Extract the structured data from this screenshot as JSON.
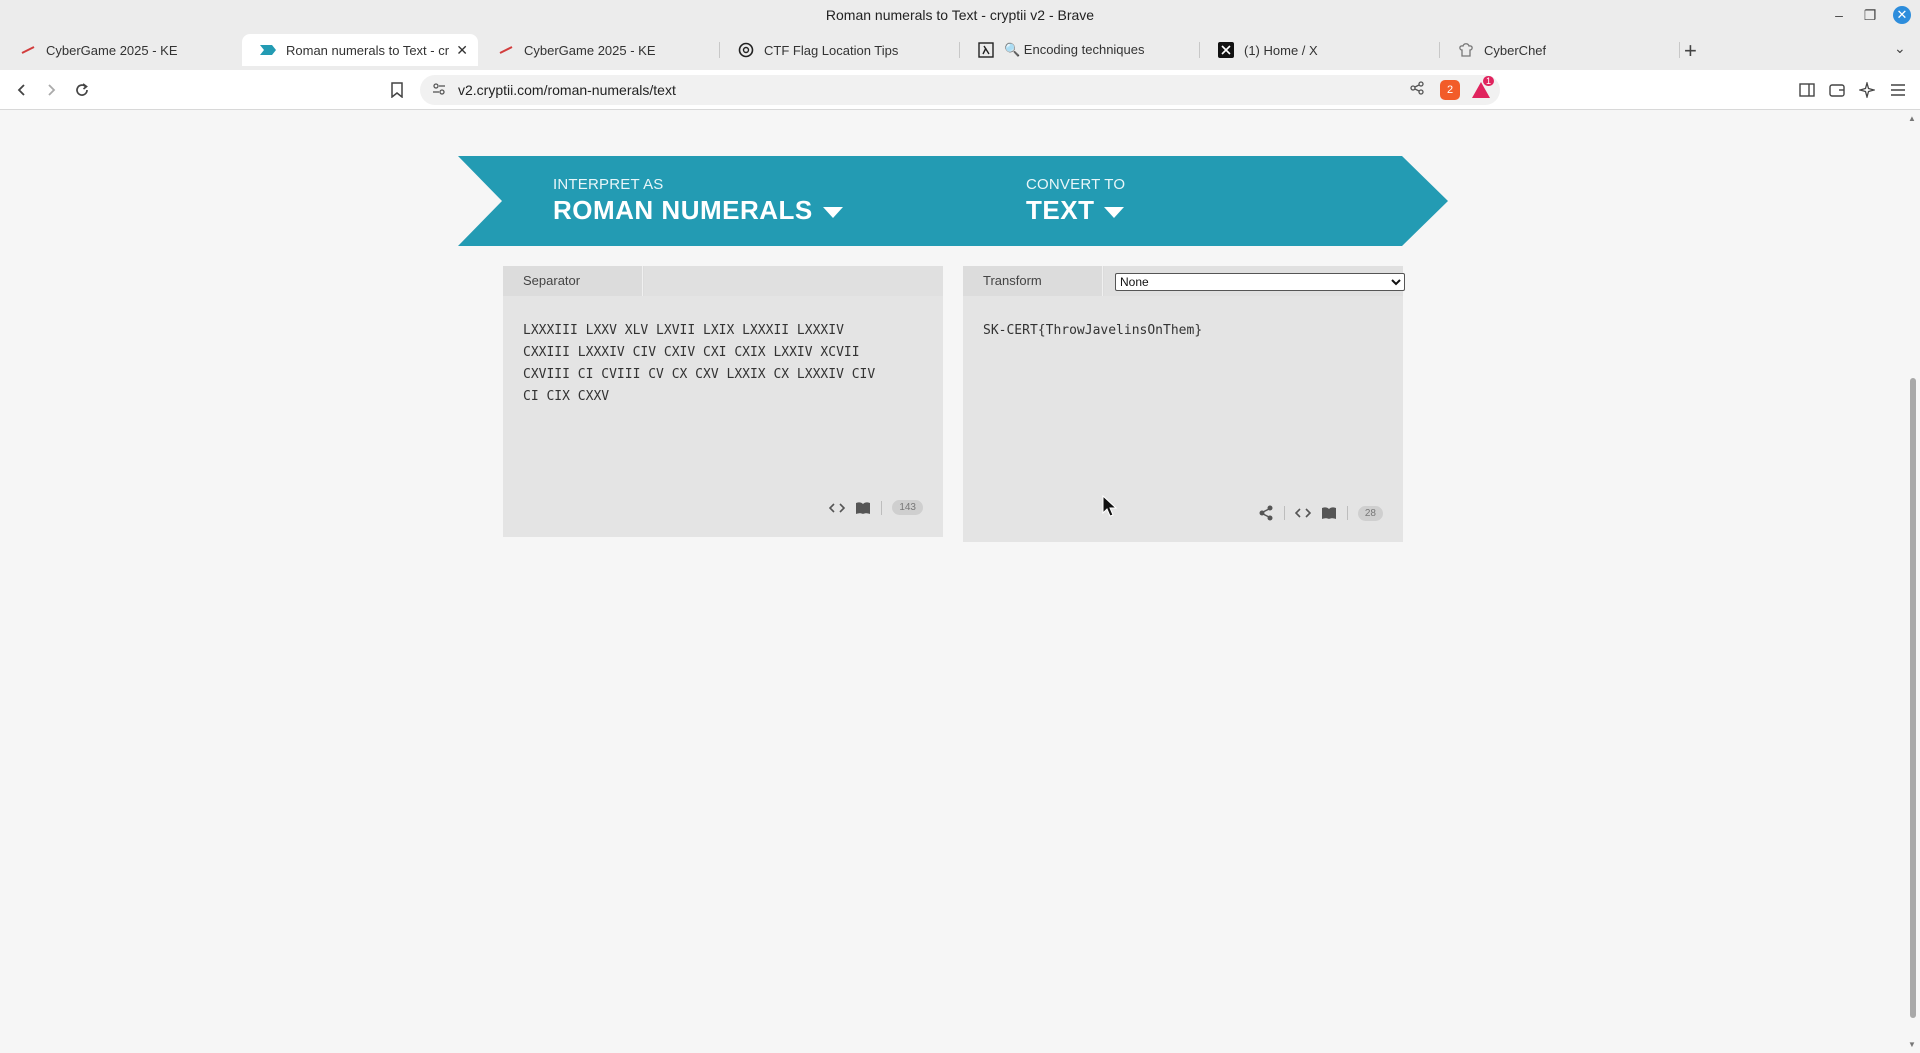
{
  "window": {
    "title": "Roman numerals to Text - cryptii v2 - Brave"
  },
  "tabs": [
    {
      "label": "CyberGame 2025 - KE",
      "icon": "cybergame-favicon",
      "active": false
    },
    {
      "label": "Roman numerals to Text - cr",
      "icon": "cryptii-favicon",
      "active": true
    },
    {
      "label": "CyberGame 2025 - KE",
      "icon": "cybergame-favicon",
      "active": false
    },
    {
      "label": "CTF Flag Location Tips",
      "icon": "chatgpt-favicon",
      "active": false
    },
    {
      "label": "🔍 Encoding techniques",
      "icon": "lambda-favicon",
      "active": false
    },
    {
      "label": "(1) Home / X",
      "icon": "x-favicon",
      "active": false
    },
    {
      "label": "CyberChef",
      "icon": "cyberchef-favicon",
      "active": false
    }
  ],
  "toolbar": {
    "url": "v2.cryptii.com/roman-numerals/text",
    "shield_count": "2",
    "rewards_count": "1"
  },
  "banner": {
    "left_label": "INTERPRET AS",
    "left_value": "ROMAN NUMERALS",
    "right_label": "CONVERT TO",
    "right_value": "TEXT",
    "color": "#239bb3"
  },
  "input_panel": {
    "header_label": "Separator",
    "text": "LXXXIII LXXV XLV LXVII LXIX LXXXII LXXXIV\nCXXIII LXXXIV CIV CXIV CXI CXIX LXXIV XCVII\nCXVIII CI CVIII CV CX CXV LXXIX CX LXXXIV CIV\nCI CIX CXXV",
    "count": "143"
  },
  "output_panel": {
    "header_label": "Transform",
    "transform_value": "None",
    "text": "SK-CERT{ThrowJavelinsOnThem}",
    "count": "28"
  }
}
